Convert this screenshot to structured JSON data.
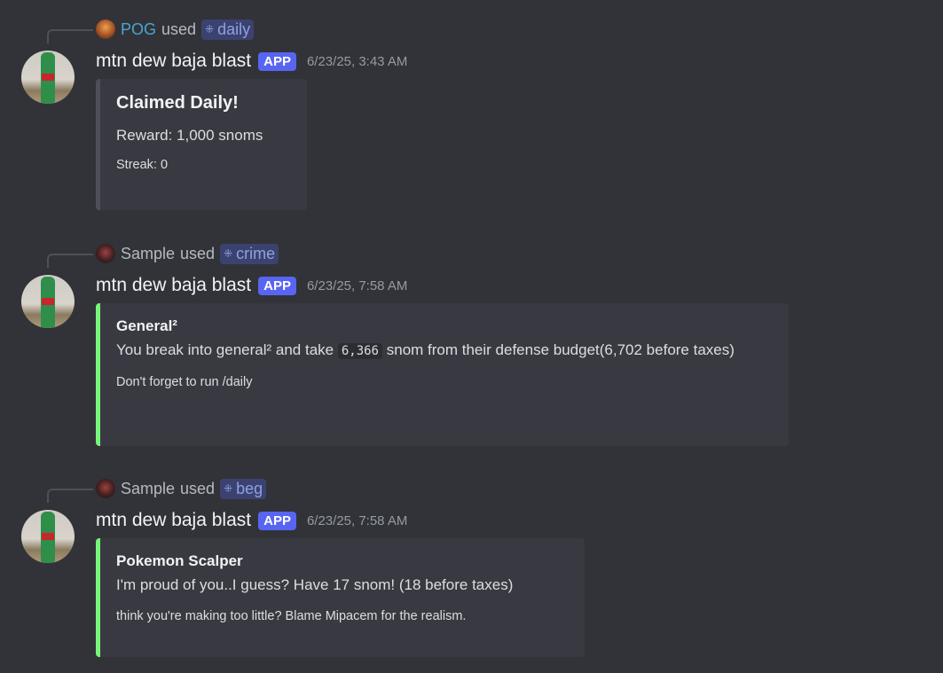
{
  "messages": [
    {
      "user": "POG",
      "used": "used",
      "command": "daily",
      "bot": "mtn dew baja blast",
      "tag": "APP",
      "time": "6/23/25, 3:43 AM",
      "embed": {
        "title": "Claimed Daily!",
        "description": "Reward: 1,000 snoms",
        "footer": "Streak: 0",
        "color": "#4e5058"
      }
    },
    {
      "user": "Sample",
      "used": "used",
      "command": "crime",
      "bot": "mtn dew baja blast",
      "tag": "APP",
      "time": "6/23/25, 7:58 AM",
      "embed": {
        "title": "General²",
        "desc_pre": "You break into general² and take",
        "amount": "6,366",
        "desc_post": "snom from their defense budget(6,702 before taxes)",
        "footer": "Don't forget to run /daily",
        "color": "#77f57a"
      }
    },
    {
      "user": "Sample",
      "used": "used",
      "command": "beg",
      "bot": "mtn dew baja blast",
      "tag": "APP",
      "time": "6/23/25, 7:58 AM",
      "embed": {
        "title": "Pokemon Scalper",
        "description": "I'm proud of you..I guess? Have 17 snom! (18 before taxes)",
        "footer": "think you're making too little? Blame Mipacem for the realism.",
        "color": "#77f57a"
      }
    }
  ]
}
